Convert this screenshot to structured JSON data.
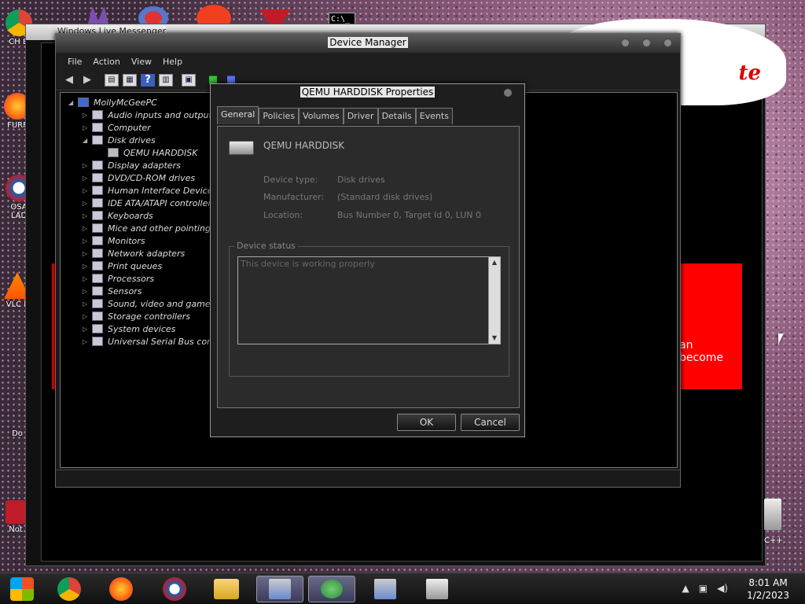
{
  "background_windows": {
    "messenger_title": "Windows Live Messenger",
    "red_panel_text": "an become",
    "cloud_text": "te",
    "side_text": "C++"
  },
  "desktop_icons": [
    {
      "label": "CH\nD"
    },
    {
      "label": "FURF"
    },
    {
      "label": "OSA\nLAD"
    },
    {
      "label": "VLC\nP"
    },
    {
      "label": "Do"
    },
    {
      "label": "Not"
    }
  ],
  "device_manager": {
    "title": "Device Manager",
    "menu": [
      "File",
      "Action",
      "View",
      "Help"
    ],
    "tree": {
      "root": "MollyMcGeePC",
      "items": [
        {
          "label": "Audio inputs and outputs",
          "expanded": false
        },
        {
          "label": "Computer",
          "expanded": false
        },
        {
          "label": "Disk drives",
          "expanded": true,
          "children": [
            "QEMU HARDDISK"
          ]
        },
        {
          "label": "Display adapters",
          "expanded": false
        },
        {
          "label": "DVD/CD-ROM drives",
          "expanded": false
        },
        {
          "label": "Human Interface Devices",
          "expanded": false
        },
        {
          "label": "IDE ATA/ATAPI controllers",
          "expanded": false
        },
        {
          "label": "Keyboards",
          "expanded": false
        },
        {
          "label": "Mice and other pointing de",
          "expanded": false
        },
        {
          "label": "Monitors",
          "expanded": false
        },
        {
          "label": "Network adapters",
          "expanded": false
        },
        {
          "label": "Print queues",
          "expanded": false
        },
        {
          "label": "Processors",
          "expanded": false
        },
        {
          "label": "Sensors",
          "expanded": false
        },
        {
          "label": "Sound, video and game cc",
          "expanded": false
        },
        {
          "label": "Storage controllers",
          "expanded": false
        },
        {
          "label": "System devices",
          "expanded": false
        },
        {
          "label": "Universal Serial Bus contr",
          "expanded": false
        }
      ]
    }
  },
  "properties_dialog": {
    "title": "QEMU HARDDISK Properties",
    "tabs": [
      "General",
      "Policies",
      "Volumes",
      "Driver",
      "Details",
      "Events"
    ],
    "active_tab": "General",
    "device_name": "QEMU HARDDISK",
    "properties": [
      {
        "label": "Device type:",
        "value": "Disk drives"
      },
      {
        "label": "Manufacturer:",
        "value": "(Standard disk drives)"
      },
      {
        "label": "Location:",
        "value": "Bus Number 0, Target Id 0, LUN 0"
      }
    ],
    "device_status_label": "Device status",
    "device_status_text": "This device is working properly",
    "ok_label": "OK",
    "cancel_label": "Cancel"
  },
  "taskbar": {
    "time": "8:01 AM",
    "date": "1/2/2023"
  }
}
